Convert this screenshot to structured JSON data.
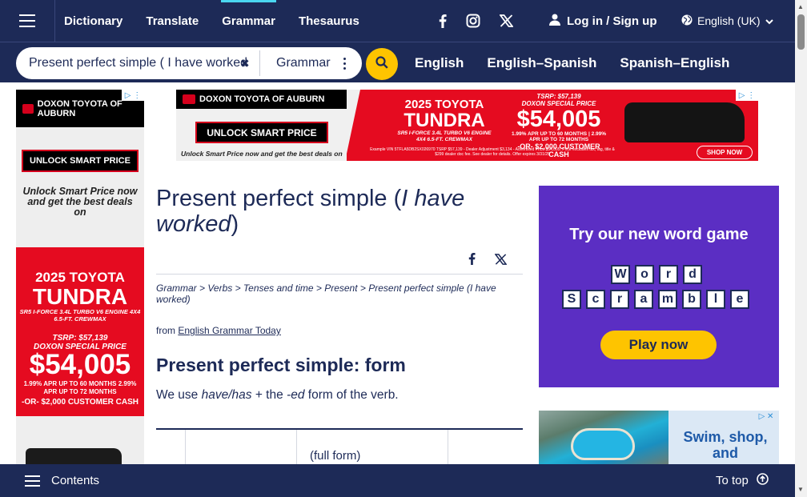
{
  "nav": {
    "links": [
      "Dictionary",
      "Translate",
      "Grammar",
      "Thesaurus"
    ],
    "active": "Grammar",
    "login_label": "Log in / Sign up",
    "language_label": "English (UK)"
  },
  "search": {
    "value": "Present perfect simple ( I have worked",
    "dictionary_label": "Grammar",
    "dict_links": [
      "English",
      "English–Spanish",
      "Spanish–English"
    ]
  },
  "left_ad": {
    "dealer": "DOXON TOYOTA OF AUBURN",
    "button": "UNLOCK SMART PRICE",
    "tagline": "Unlock Smart Price now and get the best deals on",
    "year_model": "2025 TOYOTA",
    "model": "TUNDRA",
    "spec": "SR5 I-FORCE 3.4L TURBO V6 ENGINE 4X4 6.5-FT. CREWMAX",
    "tsrp": "TSRP: $57,139",
    "special": "DOXON SPECIAL PRICE",
    "price": "$54,005",
    "apr": "1.99% APR UP TO 60 MONTHS 2.99% APR UP TO 72 MONTHS",
    "cash": "-OR- $2,000 CUSTOMER CASH"
  },
  "banner_ad": {
    "dealer": "DOXON TOYOTA OF AUBURN",
    "button": "UNLOCK SMART PRICE",
    "tagline": "Unlock Smart Price now and get the best deals on",
    "year_model": "2025 TOYOTA",
    "model": "TUNDRA",
    "spec": "SR5 I-FORCE 3.4L TURBO V6 ENGINE 4X4 6.5-FT. CREWMAX",
    "tsrp": "TSRP: $57,139",
    "special": "DOXON SPECIAL PRICE",
    "price": "$54,005",
    "apr": "1.99% APR UP TO 60 MONTHS | 2.99% APR UP TO 72 MONTHS",
    "cash": "-OR- $2,000 CUSTOMER CASH",
    "fine_print": "Example VIN 5TFLA5DB2SX026970 TSRP $57,139 - Dealer Adjustment $3,134 - Advertised Price $54,005. Price excludes tax, tag, title & $299 dealer doc fee. See dealer for details. Offer expires 3/31/25",
    "shop": "SHOP NOW"
  },
  "article": {
    "title_start": "Present perfect simple (",
    "title_italic": "I have worked",
    "title_end": ")",
    "breadcrumb": "Grammar > Verbs > Tenses and time > Present > Present perfect simple (I have worked)",
    "from_prefix": "from",
    "from_link": "English Grammar Today",
    "section_heading": "Present perfect simple: form",
    "body_1": "We use",
    "body_italic_1": "have/has",
    "body_2": "+ the",
    "body_italic_2": "-ed",
    "body_3": "form of the verb.",
    "table_cell": "(full form)"
  },
  "game_ad": {
    "title": "Try our new word game",
    "word1": [
      "W",
      "o",
      "r",
      "d"
    ],
    "word2": [
      "S",
      "c",
      "r",
      "a",
      "m",
      "b",
      "l",
      "e"
    ],
    "button": "Play now"
  },
  "resort_ad": {
    "text": "Swim, shop, and"
  },
  "bottom": {
    "contents_label": "Contents",
    "top_label": "To top"
  }
}
